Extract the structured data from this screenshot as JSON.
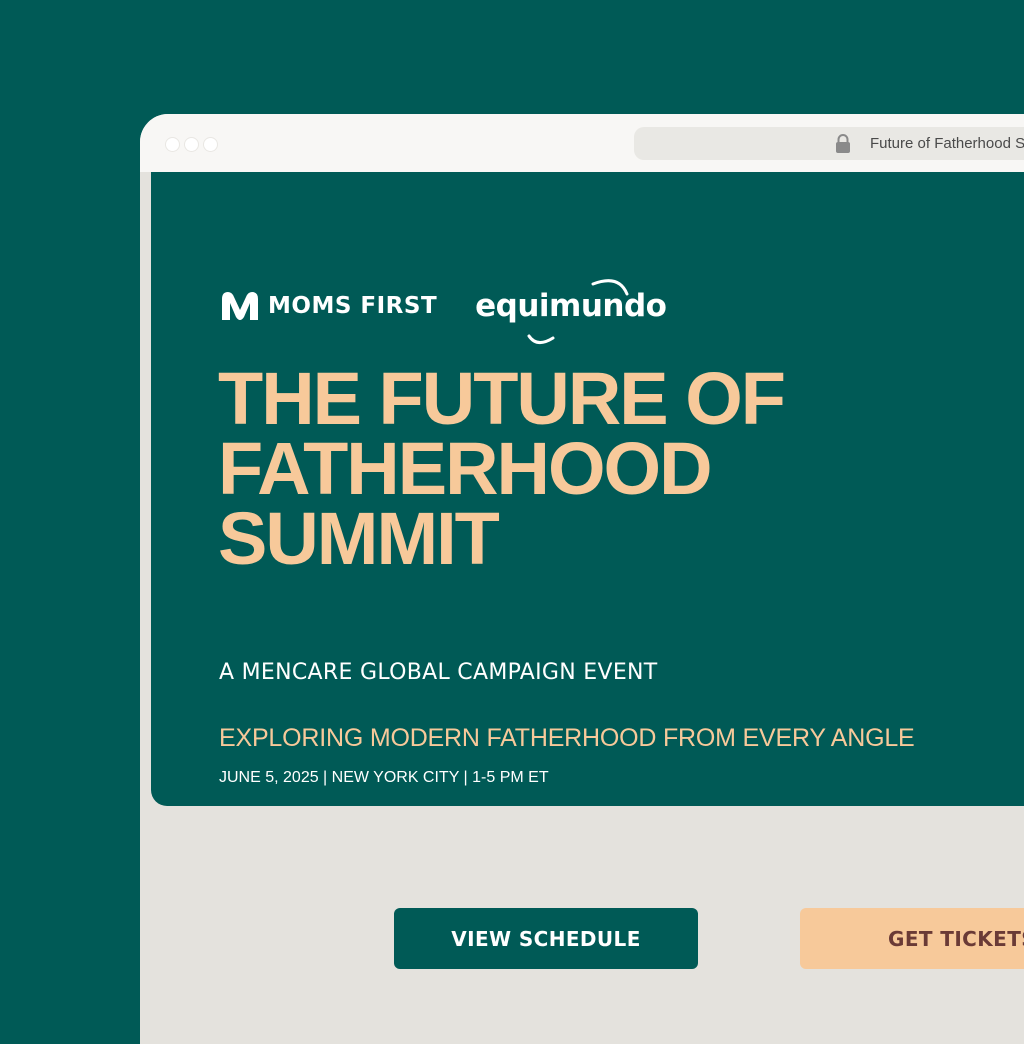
{
  "browser": {
    "url_text": "Future of Fatherhood S",
    "lock_icon": "lock-icon"
  },
  "logos": {
    "moms_first": "MOMS FIRST",
    "equimundo": "equimundo"
  },
  "hero": {
    "title_lines": [
      "THE FUTURE OF",
      "FATHERHOOD",
      "SUMMIT"
    ],
    "subtitle": "A MENCARE GLOBAL CAMPAIGN EVENT",
    "tagline": "EXPLORING MODERN FATHERHOOD FROM EVERY ANGLE",
    "event_info": "JUNE 5, 2025 | NEW YORK CITY | 1-5 PM ET"
  },
  "actions": {
    "view_schedule": "VIEW SCHEDULE",
    "get_tickets": "GET TICKETS"
  },
  "colors": {
    "background": "#005a56",
    "accent": "#f7c99a",
    "page": "#e4e2dd",
    "tickets_text": "#6a3a36"
  }
}
